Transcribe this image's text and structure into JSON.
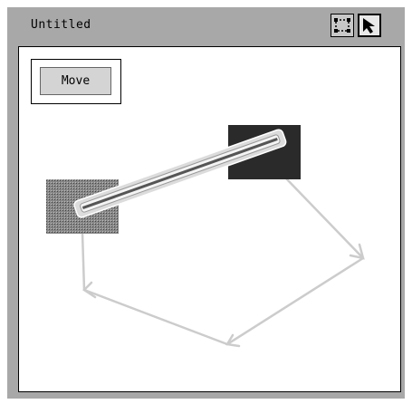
{
  "window": {
    "title": "Untitled"
  },
  "toolbar": {
    "tools": [
      {
        "icon": "selection-rectangle-icon"
      },
      {
        "icon": "pointer-arrow-icon",
        "selected": true
      }
    ]
  },
  "mode_button": {
    "label": "Move"
  },
  "colors": {
    "frame": "#a8a8a8",
    "canvas": "#ffffff",
    "dark_node": "#2a2a2a",
    "edge": "#cccccc"
  }
}
